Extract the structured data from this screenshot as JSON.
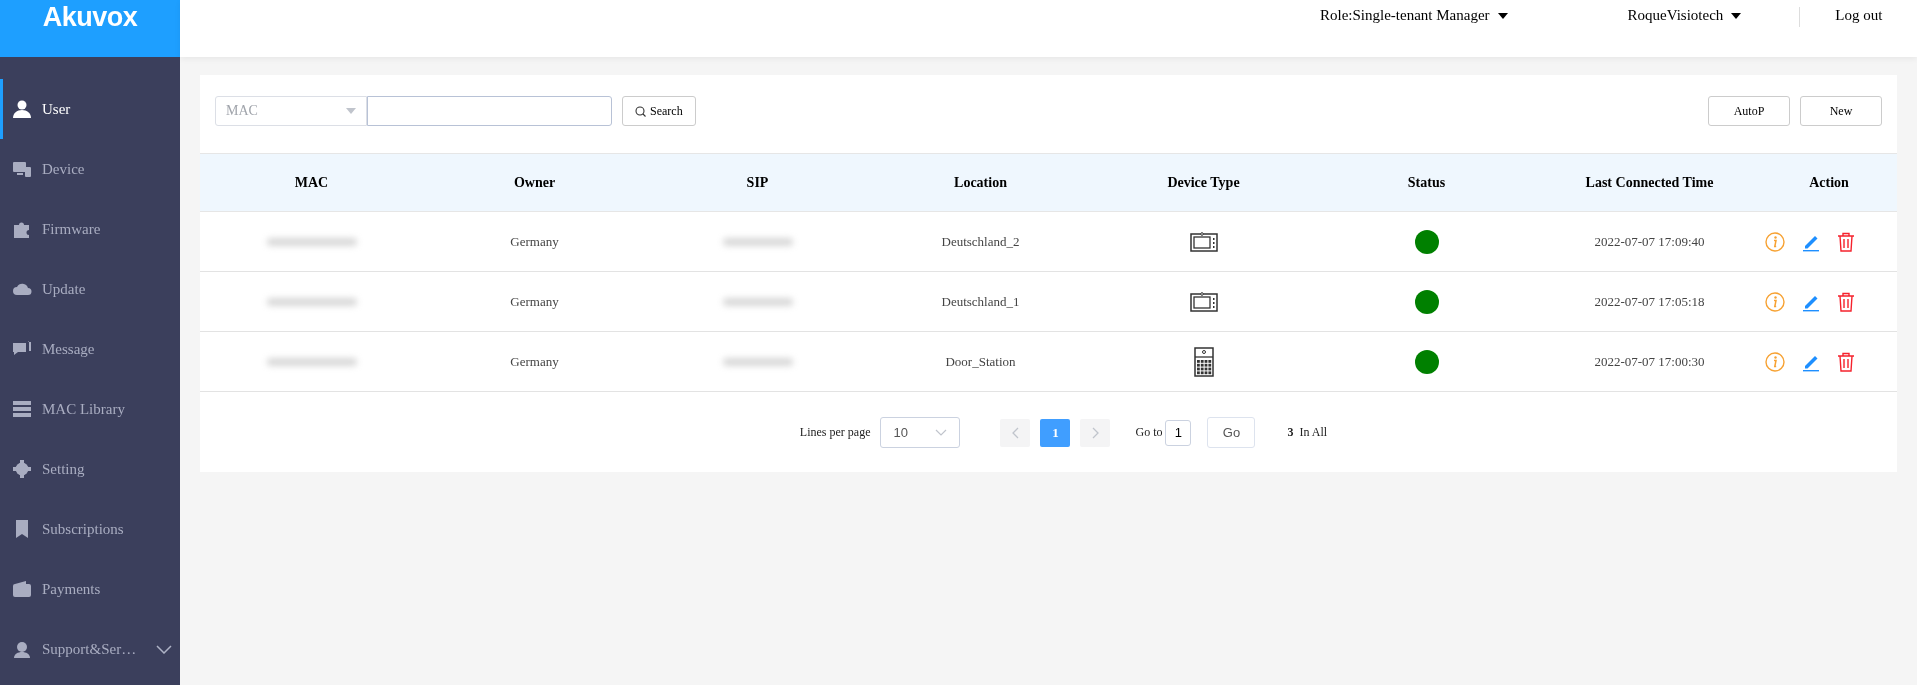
{
  "logo": "Akuvox",
  "header": {
    "role": "Role:Single-tenant Manager",
    "account": "RoqueVisiotech",
    "logout": "Log out"
  },
  "sidebar": {
    "items": [
      {
        "label": "User",
        "selected": true
      },
      {
        "label": "Device",
        "selected": false
      },
      {
        "label": "Firmware",
        "selected": false
      },
      {
        "label": "Update",
        "selected": false
      },
      {
        "label": "Message",
        "selected": false
      },
      {
        "label": "MAC Library",
        "selected": false
      },
      {
        "label": "Setting",
        "selected": false
      },
      {
        "label": "Subscriptions",
        "selected": false
      },
      {
        "label": "Payments",
        "selected": false
      },
      {
        "label": "Support&Ser…",
        "selected": false,
        "expanded": false
      }
    ]
  },
  "toolbar": {
    "filter": "MAC",
    "search_button": "Search",
    "buttons": [
      "AutoP",
      "New"
    ]
  },
  "table": {
    "columns": [
      "MAC",
      "Owner",
      "SIP",
      "Location",
      "Device Type",
      "Status",
      "Last Connected Time",
      "Action"
    ],
    "rows": [
      {
        "owner": "Germany",
        "location": "Deutschland_2",
        "kind": "monitor",
        "color": "#008000",
        "time": "2022-07-07 17:09:40"
      },
      {
        "owner": "Germany",
        "location": "Deutschland_1",
        "kind": "monitor",
        "color": "#008000",
        "time": "2022-07-07 17:05:18"
      },
      {
        "owner": "Germany",
        "location": "Door_Station",
        "kind": "keypad",
        "color": "#008000",
        "time": "2022-07-07 17:00:30"
      }
    ]
  },
  "pagination": {
    "lines_label": "Lines per page",
    "lines_value": "10",
    "pages": [
      {
        "label": "1",
        "selected": true
      }
    ],
    "goto_label": "Go to",
    "goto_value": "1",
    "go_button": "Go",
    "total": "3",
    "total_label": "In All"
  }
}
